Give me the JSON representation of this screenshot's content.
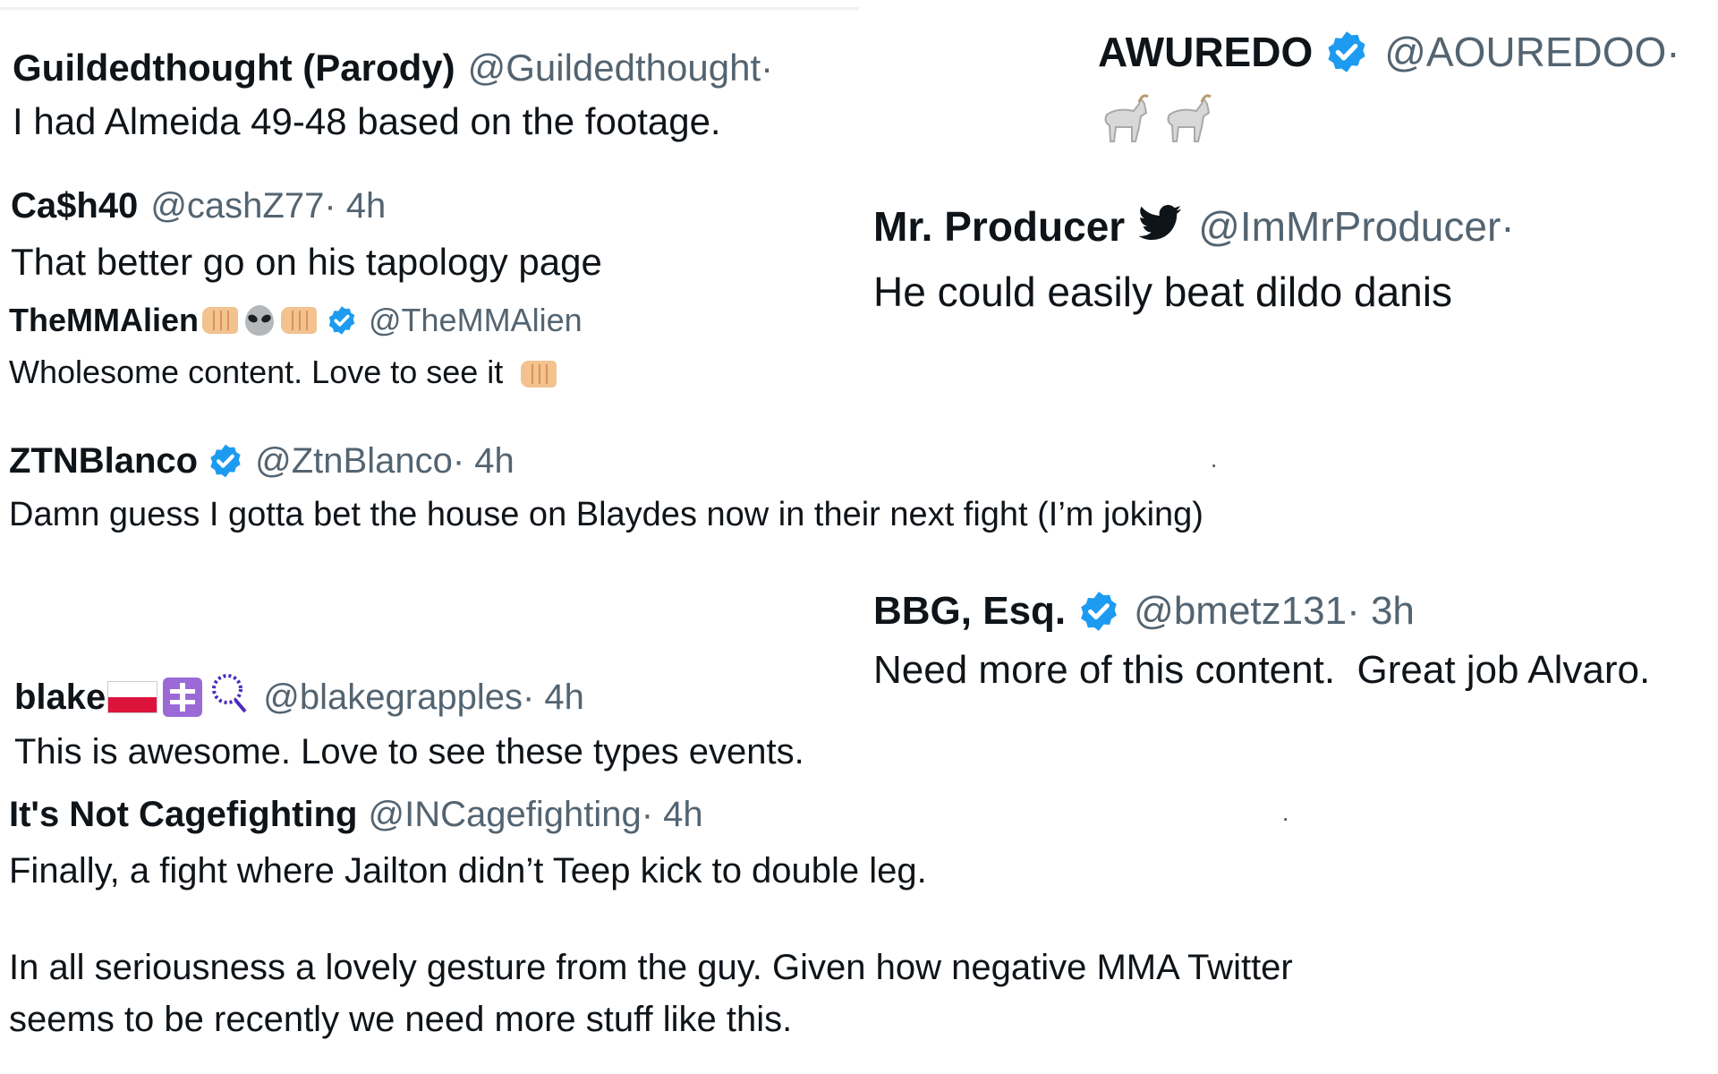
{
  "tweets": [
    {
      "name": "Guildedthought (Parody)",
      "handle": "@Guildedthought",
      "meta": " ·",
      "text": "I had Almeida 49-48 based on the footage."
    },
    {
      "name": "Ca$h40",
      "handle": "@cashZ77",
      "meta": " · 4h",
      "text": "That better go on his tapology page"
    },
    {
      "name": "TheMMAlien",
      "handle": "@TheMMAlien",
      "meta": "",
      "text": "Wholesome content. Love to see it"
    },
    {
      "name": "ZTNBlanco",
      "handle": "@ZtnBlanco",
      "meta": " · 4h",
      "text": "Damn guess I gotta bet the house on Blaydes now in their next fight (I’m joking)"
    },
    {
      "name": "blake",
      "handle": "@blakegrapples",
      "meta": " · 4h",
      "text": "This is awesome. Love to see these types events."
    },
    {
      "name": "It's Not Cagefighting",
      "handle": "@INCagefighting",
      "meta": " · 4h",
      "text": "Finally, a fight where Jailton didn’t Teep kick to double leg.",
      "text2": "In all seriousness a lovely gesture from the guy. Given how negative MMA Twitter seems to be recently we need more stuff like this."
    },
    {
      "name": "AWUREDO",
      "handle": "@AOUREDOO",
      "meta": " ·",
      "text": ""
    },
    {
      "name": "Mr. Producer",
      "handle": "@ImMrProducer",
      "meta": " ·",
      "text": "He could easily beat dildo danis"
    },
    {
      "name": "BBG, Esq.",
      "handle": "@bmetz131",
      "meta": " · 3h",
      "text": "Need more of this content.  Great job Alvaro."
    }
  ],
  "stray_dots": [
    "·",
    "·"
  ],
  "icons": {
    "verified": "verified-badge-icon",
    "fist": "oncoming-fist-emoji",
    "alien": "alien-emoji",
    "goat": "goat-emoji",
    "flag": "poland-flag-emoji",
    "cross": "orthodox-cross-emoji",
    "rosary": "prayer-beads-emoji",
    "bird": "twitter-bird-icon"
  },
  "colors": {
    "text": "#0f1419",
    "muted": "#536471",
    "verified": "#1d9bf0"
  }
}
